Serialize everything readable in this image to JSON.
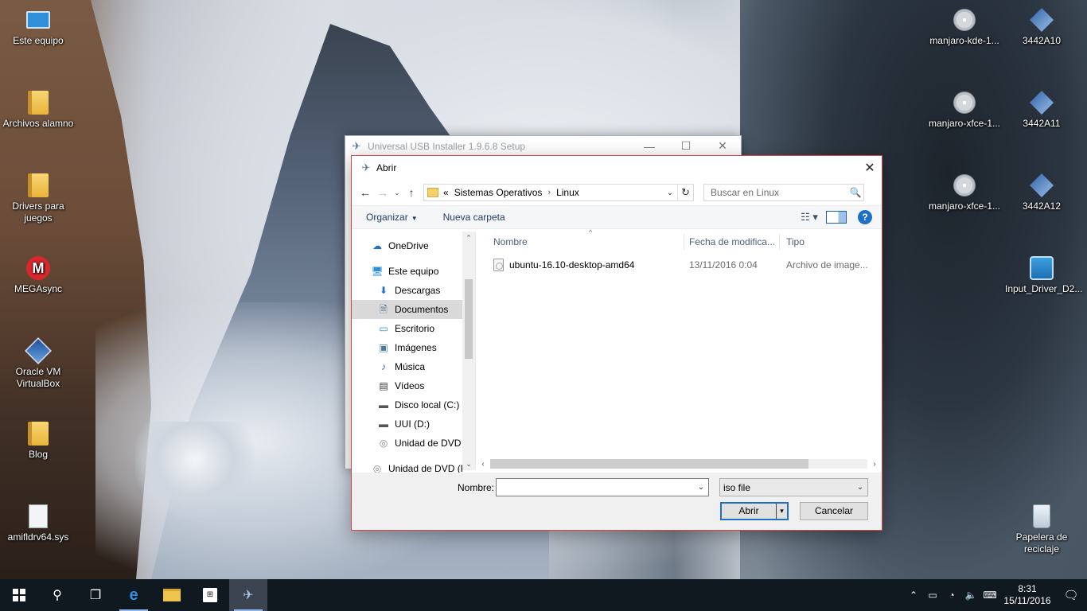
{
  "desktop": {
    "left_icons": [
      {
        "label": "Este equipo",
        "icon": "computer-icon"
      },
      {
        "label": "Archivos alamno",
        "icon": "folder-icon"
      },
      {
        "label": "Drivers para juegos",
        "icon": "folder-icon"
      },
      {
        "label": "MEGAsync",
        "icon": "mega-icon"
      },
      {
        "label": "Oracle VM VirtualBox",
        "icon": "virtualbox-icon"
      },
      {
        "label": "Blog",
        "icon": "folder-icon"
      },
      {
        "label": "amifldrv64.sys",
        "icon": "system-file-icon"
      }
    ],
    "right_icons": [
      {
        "label": "manjaro-kde-1...",
        "icon": "disc-image-icon"
      },
      {
        "label": "3442A10",
        "icon": "usb-installer-icon"
      },
      {
        "label": "manjaro-xfce-1...",
        "icon": "disc-image-icon"
      },
      {
        "label": "3442A11",
        "icon": "usb-installer-icon"
      },
      {
        "label": "manjaro-xfce-1...",
        "icon": "disc-image-icon"
      },
      {
        "label": "3442A12",
        "icon": "usb-installer-icon"
      },
      {
        "label": "Input_Driver_D2...",
        "icon": "driver-installer-icon"
      },
      {
        "label": "Papelera de reciclaje",
        "icon": "recycle-bin-icon"
      }
    ]
  },
  "setup_window": {
    "title": "Universal USB Installer 1.9.6.8 Setup",
    "minimize": "—",
    "maximize": "☐",
    "close": "✕"
  },
  "dialog": {
    "title": "Abrir",
    "close": "✕",
    "nav": {
      "back": "←",
      "forward": "→",
      "recent": "⌄",
      "up": "↑"
    },
    "address": {
      "prefix": "«",
      "crumbs": [
        "Sistemas Operativos",
        "Linux"
      ],
      "separator": "›",
      "dropdown": "⌄",
      "refresh": "↻"
    },
    "search": {
      "placeholder": "Buscar en Linux",
      "icon": "🔍"
    },
    "toolbar": {
      "organize": "Organizar",
      "new_folder": "Nueva carpeta",
      "view": "☷ ▾",
      "help": "?"
    },
    "nav_pane": [
      {
        "label": "OneDrive",
        "icon": "☁",
        "level": 0,
        "color": "#1f6fc9"
      },
      {
        "label": "Este equipo",
        "icon": "🖥",
        "level": 0,
        "color": "#2f8fd8"
      },
      {
        "label": "Descargas",
        "icon": "⬇",
        "level": 1,
        "color": "#1f6fc9"
      },
      {
        "label": "Documentos",
        "icon": "🗎",
        "level": 1,
        "color": "#4a6a8a",
        "selected": true
      },
      {
        "label": "Escritorio",
        "icon": "▭",
        "level": 1,
        "color": "#2f8fd8"
      },
      {
        "label": "Imágenes",
        "icon": "▣",
        "level": 1,
        "color": "#4a7aa8"
      },
      {
        "label": "Música",
        "icon": "♪",
        "level": 1,
        "color": "#1f6fc9"
      },
      {
        "label": "Vídeos",
        "icon": "▤",
        "level": 1,
        "color": "#333"
      },
      {
        "label": "Disco local (C:)",
        "icon": "▬",
        "level": 1,
        "color": "#555"
      },
      {
        "label": "UUI (D:)",
        "icon": "▬",
        "level": 1,
        "color": "#555"
      },
      {
        "label": "Unidad de DVD (",
        "icon": "◎",
        "level": 1,
        "color": "#888"
      },
      {
        "label": "Unidad de DVD (F",
        "icon": "◎",
        "level": 0,
        "color": "#888"
      }
    ],
    "scroll": {
      "up": "⌃",
      "down": "⌄",
      "left": "‹",
      "right": "›"
    },
    "columns": {
      "name": "Nombre",
      "date": "Fecha de modifica...",
      "type": "Tipo",
      "sort_indicator": "^"
    },
    "files": [
      {
        "name": "ubuntu-16.10-desktop-amd64",
        "date": "13/11/2016 0:04",
        "type": "Archivo de image..."
      }
    ],
    "filename": {
      "label": "Nombre:",
      "value": "",
      "dropdown": "⌄"
    },
    "filetype": {
      "value": "iso file",
      "dropdown": "⌄"
    },
    "buttons": {
      "open": "Abrir",
      "open_split": "▾",
      "cancel": "Cancelar"
    }
  },
  "taskbar": {
    "start": "Inicio",
    "search_icon": "⚲",
    "taskview_icon": "❐",
    "edge_icon": "e",
    "explorer_icon": "folder",
    "store_icon": "⊞",
    "uui_icon": "✈",
    "tray": {
      "chevron": "⌃",
      "battery": "▭",
      "wifi": "◔",
      "volume": "🔈",
      "keyboard": "⌨"
    },
    "time": "8:31",
    "date": "15/11/2016",
    "notifications": "🗨"
  }
}
